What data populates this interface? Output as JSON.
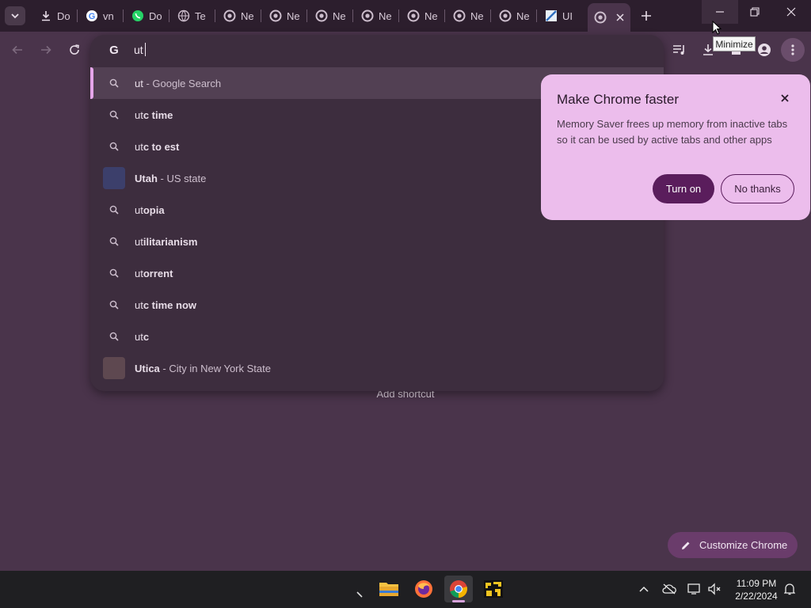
{
  "tabs": [
    {
      "label": "Do",
      "icon": "download-icon"
    },
    {
      "label": "vn",
      "icon": "google-icon"
    },
    {
      "label": "Do",
      "icon": "whatsapp-icon"
    },
    {
      "label": "Te",
      "icon": "globe-icon"
    },
    {
      "label": "Ne",
      "icon": "chrome-icon"
    },
    {
      "label": "Ne",
      "icon": "chrome-icon"
    },
    {
      "label": "Ne",
      "icon": "chrome-icon"
    },
    {
      "label": "Ne",
      "icon": "chrome-icon"
    },
    {
      "label": "Ne",
      "icon": "chrome-icon"
    },
    {
      "label": "Ne",
      "icon": "chrome-icon"
    },
    {
      "label": "Ne",
      "icon": "chrome-icon"
    },
    {
      "label": "UI",
      "icon": "image-icon"
    }
  ],
  "omnibox": {
    "value": "ut",
    "suggestions": [
      {
        "bold": "",
        "prefix": "ut",
        "suffix": " - Google Search",
        "kind": "search"
      },
      {
        "prefix": "ut",
        "bold": "c time",
        "suffix": "",
        "kind": "search"
      },
      {
        "prefix": "ut",
        "bold": "c to est",
        "suffix": "",
        "kind": "search"
      },
      {
        "prefix": "Utah",
        "bold": "",
        "suffix": " - US state",
        "kind": "entity"
      },
      {
        "prefix": "ut",
        "bold": "opia",
        "suffix": "",
        "kind": "search"
      },
      {
        "prefix": "ut",
        "bold": "ilitarianism",
        "suffix": "",
        "kind": "search"
      },
      {
        "prefix": "ut",
        "bold": "orrent",
        "suffix": "",
        "kind": "search"
      },
      {
        "prefix": "ut",
        "bold": "c time now",
        "suffix": "",
        "kind": "search"
      },
      {
        "prefix": "ut",
        "bold": "c",
        "suffix": "",
        "kind": "search"
      },
      {
        "prefix": "Utica",
        "bold": "",
        "suffix": " - City in New York State",
        "kind": "entity"
      }
    ]
  },
  "popup": {
    "title": "Make Chrome faster",
    "body": "Memory Saver frees up memory from inactive tabs so it can be used by active tabs and other apps",
    "primary": "Turn on",
    "secondary": "No thanks"
  },
  "page": {
    "add_shortcut": "Add shortcut",
    "customize": "Customize Chrome"
  },
  "tooltip": "Minimize",
  "clock": {
    "time": "11:09 PM",
    "date": "2/22/2024"
  },
  "colors": {
    "accent": "#5a1d5c",
    "popup_bg": "#ecbdec",
    "page_bg": "#4a344b"
  }
}
